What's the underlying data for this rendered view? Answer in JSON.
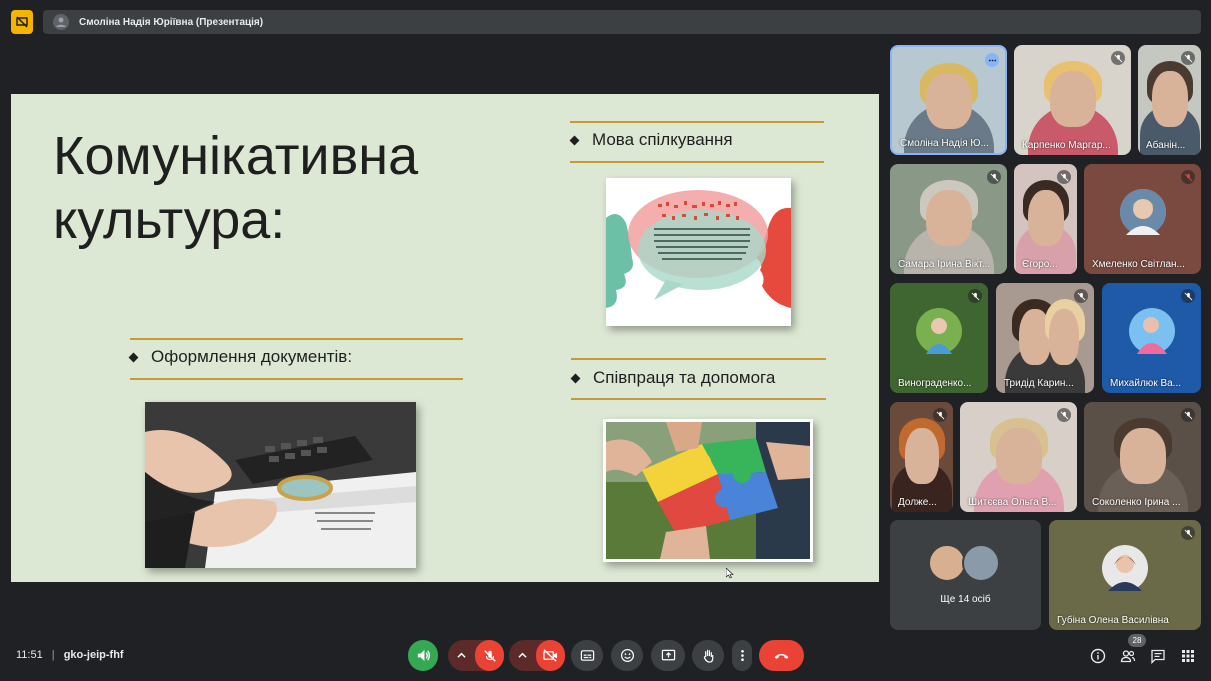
{
  "window": {
    "presenter_title": "Смоліна Надія Юріївна (Презентація)"
  },
  "slide": {
    "title_line1": "Комунікативна",
    "title_line2": "культура:",
    "bullet1": "Мова спілкування",
    "bullet2": "Оформлення документів:",
    "bullet3": "Співпраця та допомога"
  },
  "participants": [
    {
      "name": "Смоліна Надія Ю...",
      "muted": false
    },
    {
      "name": "Карпенко Маргар...",
      "muted": true
    },
    {
      "name": "Абанін...",
      "muted": true
    },
    {
      "name": "Самара Ірина Вікт...",
      "muted": true
    },
    {
      "name": "Єгоро...",
      "muted": true
    },
    {
      "name": "Хмеленко Світлан...",
      "muted": true
    },
    {
      "name": "Винограденко...",
      "muted": true
    },
    {
      "name": "Тридід Карин...",
      "muted": true
    },
    {
      "name": "Михайлюк Ва...",
      "muted": true
    },
    {
      "name": "Долже...",
      "muted": true
    },
    {
      "name": "Шитєєва Ольга В...",
      "muted": true
    },
    {
      "name": "Соколенко Ірина ...",
      "muted": true
    },
    {
      "name": "Губіна Олена Василівна",
      "muted": true
    }
  ],
  "more_tile": {
    "label": "Ще 14 осіб"
  },
  "bottom_bar": {
    "time": "11:51",
    "separator": "|",
    "meeting_code": "gko-jeip-fhf",
    "people_count": "28"
  },
  "colors": {
    "accent_red": "#ea4335",
    "accent_green": "#34a853",
    "slide_bg": "#dde8d4",
    "rule_gold": "#c49a3a"
  },
  "icons": [
    "presentation-icon",
    "speaker-icon",
    "mic-off-icon",
    "camera-off-icon",
    "captions-icon",
    "emoji-icon",
    "present-icon",
    "raise-hand-icon",
    "more-vert-icon",
    "end-call-icon",
    "info-icon",
    "people-icon",
    "chat-icon",
    "activities-icon"
  ]
}
